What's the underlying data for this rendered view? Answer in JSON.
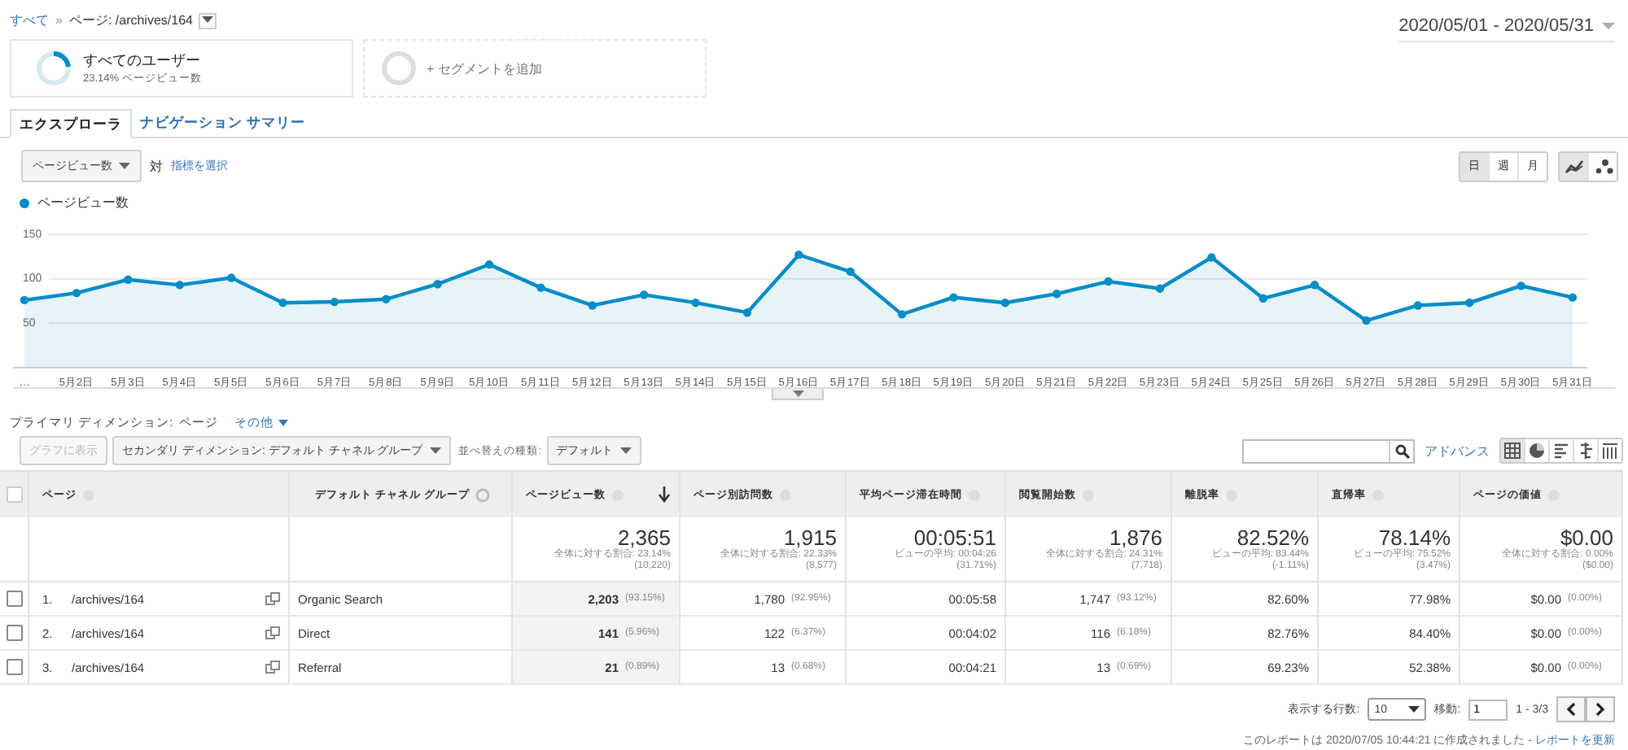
{
  "breadcrumb": {
    "root": "すべて",
    "separator": "»",
    "current": "ページ: /archives/164"
  },
  "date_range": "2020/05/01 - 2020/05/31",
  "segments": [
    {
      "title": "すべてのユーザー",
      "subtitle": "23.14% ページビュー数",
      "level": 0.2314
    }
  ],
  "add_segment": "+ セグメントを追加",
  "tabs": [
    {
      "label": "エクスプローラ",
      "selected": true
    },
    {
      "label": "ナビゲーション サマリー",
      "selected": false
    }
  ],
  "metric_select": "ページビュー数",
  "versus": "対",
  "choose_metric": "指標を選択",
  "granularity": [
    {
      "label": "日",
      "selected": true
    },
    {
      "label": "週",
      "selected": false
    },
    {
      "label": "月",
      "selected": false
    }
  ],
  "chart_types": [
    {
      "kind": "line",
      "selected": true
    },
    {
      "kind": "motion",
      "selected": false
    }
  ],
  "chart_data": {
    "type": "area",
    "grid": true,
    "ylim": [
      0,
      150
    ],
    "yticks": [
      50,
      100,
      150
    ],
    "categories": [
      "…",
      "5月2日",
      "5月3日",
      "5月4日",
      "5月5日",
      "5月6日",
      "5月7日",
      "5月8日",
      "5月9日",
      "5月10日",
      "5月11日",
      "5月12日",
      "5月13日",
      "5月14日",
      "5月15日",
      "5月16日",
      "5月17日",
      "5月18日",
      "5月19日",
      "5月20日",
      "5月21日",
      "5月22日",
      "5月23日",
      "5月24日",
      "5月25日",
      "5月26日",
      "5月27日",
      "5月28日",
      "5月29日",
      "5月30日",
      "5月31日"
    ],
    "series": [
      {
        "name": "ページビュー数",
        "color": "#058dc7",
        "values": [
          76,
          84,
          99,
          93,
          101,
          73,
          74,
          77,
          94,
          116,
          90,
          70,
          82,
          73,
          62,
          127,
          108,
          60,
          79,
          73,
          83,
          97,
          89,
          124,
          78,
          93,
          53,
          70,
          73,
          92,
          79
        ]
      }
    ]
  },
  "primary_dimension": {
    "label": "プライマリ ディメンション:",
    "value": "ページ",
    "other": "その他"
  },
  "plot_rows": {
    "label": "グラフに表示",
    "disabled": true
  },
  "secondary_dimension": "セカンダリ ディメンション: デフォルト チャネル グループ",
  "sort_label": "並べ替えの種類:",
  "sort_value": "デフォルト",
  "advanced": "アドバンス",
  "view_modes": [
    {
      "kind": "table",
      "selected": true
    },
    {
      "kind": "pie",
      "selected": false
    },
    {
      "kind": "bar",
      "selected": false
    },
    {
      "kind": "comparison",
      "selected": false
    },
    {
      "kind": "pivot",
      "selected": false
    }
  ],
  "table": {
    "select_all_checked": false,
    "columns": [
      {
        "label": "ページ",
        "kind": "help",
        "sorted": false
      },
      {
        "label": "デフォルト チャネル グループ",
        "kind": "settings",
        "sorted": false
      },
      {
        "label": "ページビュー数",
        "kind": "help",
        "sorted": true
      },
      {
        "label": "ページ別訪問数",
        "kind": "help",
        "sorted": false
      },
      {
        "label": "平均ページ滞在時間",
        "kind": "help",
        "sorted": false
      },
      {
        "label": "閲覧開始数",
        "kind": "help",
        "sorted": false
      },
      {
        "label": "離脱率",
        "kind": "help",
        "sorted": false
      },
      {
        "label": "直帰率",
        "kind": "help",
        "sorted": false
      },
      {
        "label": "ページの価値",
        "kind": "help",
        "sorted": false
      }
    ],
    "totals": [
      {
        "value": "2,365",
        "note": "全体に対する割合: 23.14%",
        "sub": "(10,220)"
      },
      {
        "value": "1,915",
        "note": "全体に対する割合: 22.33%",
        "sub": "(8,577)"
      },
      {
        "value": "00:05:51",
        "note": "ビューの平均: 00:04:26",
        "sub": "(31.71%)"
      },
      {
        "value": "1,876",
        "note": "全体に対する割合: 24.31%",
        "sub": "(7,718)"
      },
      {
        "value": "82.52%",
        "note": "ビューの平均: 83.44%",
        "sub": "(-1.11%)"
      },
      {
        "value": "78.14%",
        "note": "ビューの平均: 75.52%",
        "sub": "(3.47%)"
      },
      {
        "value": "$0.00",
        "note": "全体に対する割合: 0.00%",
        "sub": "($0.00)"
      }
    ],
    "rows": [
      {
        "index": "1.",
        "page": "/archives/164",
        "channel": "Organic Search",
        "checked": false,
        "cells": [
          {
            "value": "2,203",
            "pct": "(93.15%)"
          },
          {
            "value": "1,780",
            "pct": "(92.95%)"
          },
          {
            "value": "00:05:58"
          },
          {
            "value": "1,747",
            "pct": "(93.12%)"
          },
          {
            "value": "82.60%"
          },
          {
            "value": "77.98%"
          },
          {
            "value": "$0.00",
            "pct": "(0.00%)"
          }
        ]
      },
      {
        "index": "2.",
        "page": "/archives/164",
        "channel": "Direct",
        "checked": false,
        "cells": [
          {
            "value": "141",
            "pct": "(5.96%)"
          },
          {
            "value": "122",
            "pct": "(6.37%)"
          },
          {
            "value": "00:04:02"
          },
          {
            "value": "116",
            "pct": "(6.18%)"
          },
          {
            "value": "82.76%"
          },
          {
            "value": "84.40%"
          },
          {
            "value": "$0.00",
            "pct": "(0.00%)"
          }
        ]
      },
      {
        "index": "3.",
        "page": "/archives/164",
        "channel": "Referral",
        "checked": false,
        "cells": [
          {
            "value": "21",
            "pct": "(0.89%)"
          },
          {
            "value": "13",
            "pct": "(0.68%)"
          },
          {
            "value": "00:04:21"
          },
          {
            "value": "13",
            "pct": "(0.69%)"
          },
          {
            "value": "69.23%"
          },
          {
            "value": "52.38%"
          },
          {
            "value": "$0.00",
            "pct": "(0.00%)"
          }
        ]
      }
    ]
  },
  "pagination": {
    "rows_label": "表示する行数:",
    "rows_value": "10",
    "goto_label": "移動:",
    "goto_value": "1",
    "range": "1 - 3/3"
  },
  "footer": {
    "text": "このレポートは 2020/07/05 10:44:21 に作成されました -",
    "link": "レポートを更新"
  }
}
